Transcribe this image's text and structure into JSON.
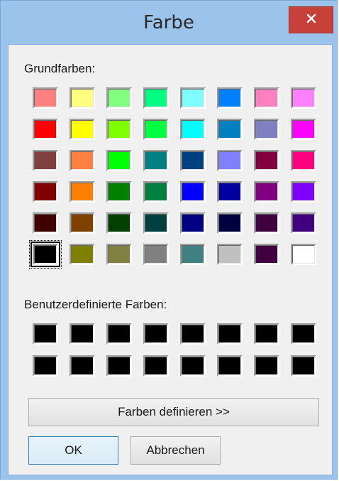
{
  "window": {
    "title": "Farbe",
    "close_icon": "close-icon"
  },
  "basic": {
    "label": "Grundfarben:",
    "colors": [
      [
        "#ff8080",
        "#ffff80",
        "#80ff80",
        "#00ff80",
        "#80ffff",
        "#0080ff",
        "#ff80c0",
        "#ff80ff"
      ],
      [
        "#ff0000",
        "#ffff00",
        "#80ff00",
        "#00ff40",
        "#00ffff",
        "#0080c0",
        "#8080c0",
        "#ff00ff"
      ],
      [
        "#804040",
        "#ff8040",
        "#00ff00",
        "#008080",
        "#004080",
        "#8080ff",
        "#800040",
        "#ff0080"
      ],
      [
        "#800000",
        "#ff8000",
        "#008000",
        "#008040",
        "#0000ff",
        "#0000a0",
        "#800080",
        "#8000ff"
      ],
      [
        "#400000",
        "#804000",
        "#004000",
        "#004040",
        "#000080",
        "#000040",
        "#400040",
        "#400080"
      ],
      [
        "#000000",
        "#808000",
        "#808040",
        "#808080",
        "#408080",
        "#c0c0c0",
        "#400040",
        "#ffffff"
      ]
    ],
    "selected_index": 40
  },
  "custom": {
    "label": "Benutzerdefinierte Farben:",
    "colors": [
      [
        "#000000",
        "#000000",
        "#000000",
        "#000000",
        "#000000",
        "#000000",
        "#000000",
        "#000000"
      ],
      [
        "#000000",
        "#000000",
        "#000000",
        "#000000",
        "#000000",
        "#000000",
        "#000000",
        "#000000"
      ]
    ]
  },
  "buttons": {
    "define": "Farben definieren >>",
    "ok": "OK",
    "cancel": "Abbrechen"
  },
  "colors": {
    "title_bar": "#9bc3ec",
    "close_button": "#c7403a",
    "dialog_bg": "#f0f0f0",
    "ok_border": "#3c7fb1"
  }
}
